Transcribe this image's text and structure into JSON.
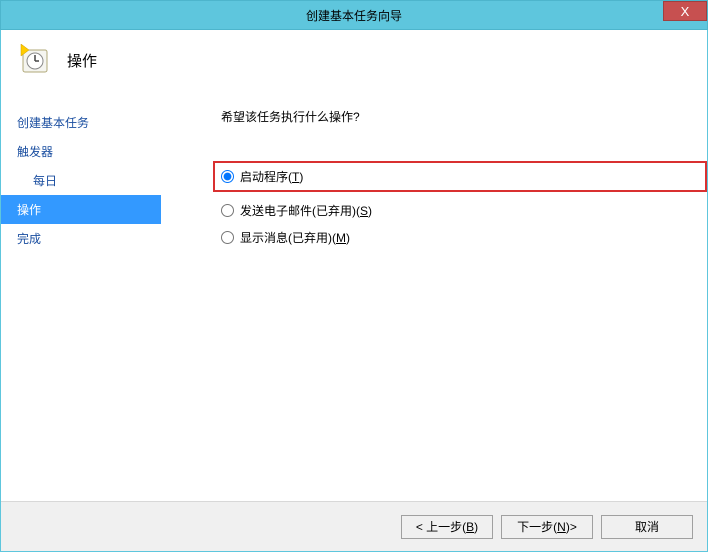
{
  "titlebar": {
    "title": "创建基本任务向导",
    "close": "X"
  },
  "header": {
    "title": "操作"
  },
  "sidebar": {
    "items": [
      {
        "label": "创建基本任务",
        "sub": false,
        "selected": false
      },
      {
        "label": "触发器",
        "sub": false,
        "selected": false
      },
      {
        "label": "每日",
        "sub": true,
        "selected": false
      },
      {
        "label": "操作",
        "sub": false,
        "selected": true
      },
      {
        "label": "完成",
        "sub": false,
        "selected": false
      }
    ]
  },
  "main": {
    "question": "希望该任务执行什么操作?",
    "options": {
      "start_program_label": "启动程序",
      "start_program_key": "T",
      "send_email_label": "发送电子邮件(已弃用)",
      "send_email_key": "S",
      "show_message_label": "显示消息(已弃用)",
      "show_message_key": "M"
    }
  },
  "footer": {
    "back_label": "< 上一步",
    "back_key": "B",
    "next_label": "下一步",
    "next_key": "N",
    "next_suffix": " >",
    "cancel_label": "取消"
  }
}
